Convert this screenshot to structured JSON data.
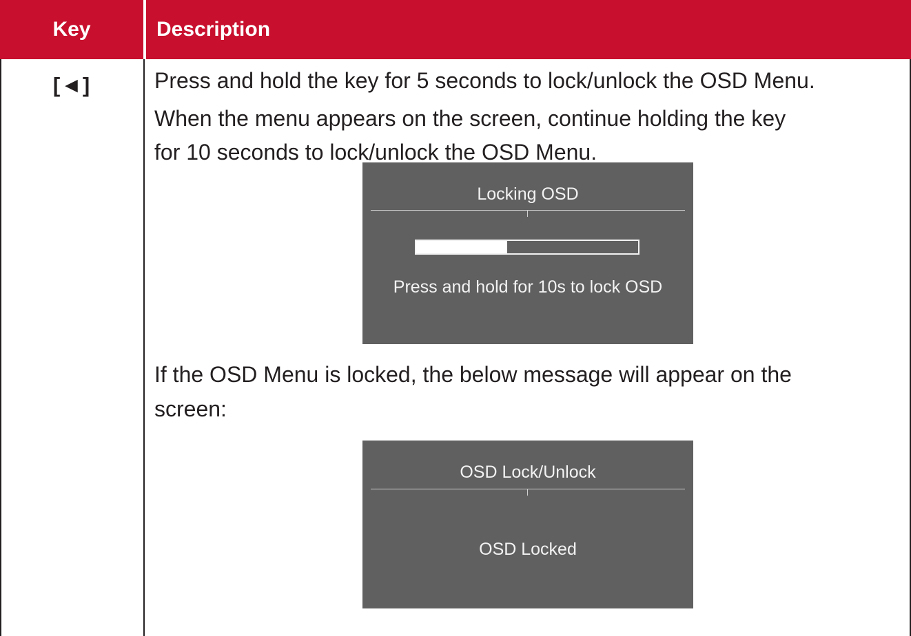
{
  "table": {
    "headers": {
      "key": "Key",
      "description": "Description"
    },
    "row": {
      "key": "[◄]",
      "paragraphs": {
        "p1": "Press and hold the key for 5 seconds to lock/unlock the OSD Menu.",
        "p2_line1": "When the menu appears on the screen, continue holding the key",
        "p2_line2": "for 10 seconds to lock/unlock the OSD Menu.",
        "p3_line1": "If the OSD Menu is locked, the below message will appear on the",
        "p3_line2": "screen:"
      }
    }
  },
  "osd_locking": {
    "title": "Locking OSD",
    "progress_fraction": 0.41,
    "message": "Press and hold for 10s to lock OSD"
  },
  "osd_locked": {
    "title": "OSD Lock/Unlock",
    "message": "OSD Locked"
  },
  "colors": {
    "header_bg": "#c8102e",
    "osd_bg": "#606060",
    "text": "#231f20"
  }
}
